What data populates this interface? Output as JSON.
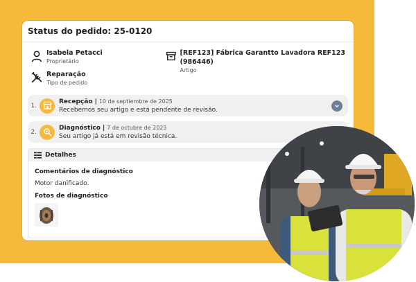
{
  "header": {
    "title": "Status do pedido: 25-0120"
  },
  "owner": {
    "name": "Isabela Petacci",
    "role": "Proprietário",
    "icon": "user-icon"
  },
  "article": {
    "name": "[REF123] Fábrica Garantto Lavadora REF123 (986446)",
    "role": "Artigo",
    "icon": "archive-box-icon"
  },
  "order_type": {
    "name": "Reparação",
    "role": "Tipo de pedido",
    "icon": "tools-icon"
  },
  "steps": [
    {
      "num": "1.",
      "title": "Recepção |",
      "date": "10 de septiembre de 2025",
      "desc": "Recebemos seu artigo e está pendente de revisão.",
      "icon": "storefront-icon"
    },
    {
      "num": "2.",
      "title": "Diagnóstico |",
      "date": "7 de octubre de 2025",
      "desc": "Seu artigo já está em revisão técnica.",
      "icon": "magnifier-icon"
    }
  ],
  "details": {
    "title": "Detalhes",
    "comments_label": "Comentários de diagnóstico",
    "comments_text": "Motor danificado.",
    "photos_label": "Fotos de diagnóstico"
  },
  "colors": {
    "accent": "#f5b93b",
    "chevron": "#6f7f94",
    "step_bg": "#f0f0f0"
  }
}
